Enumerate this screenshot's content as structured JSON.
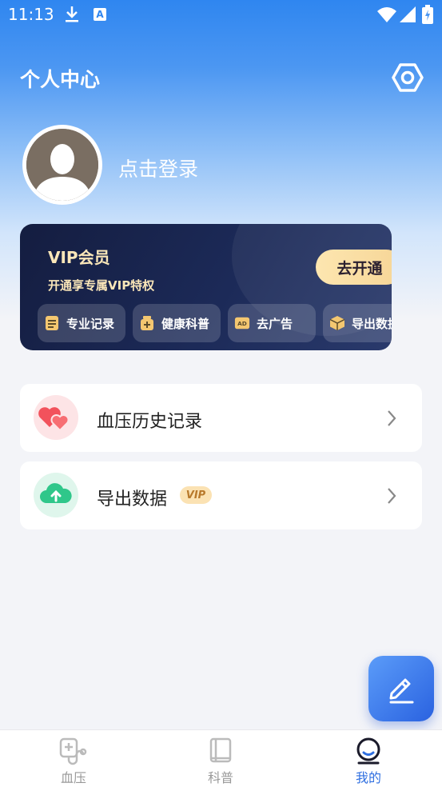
{
  "status_bar": {
    "time": "11:13"
  },
  "header": {
    "title": "个人中心"
  },
  "profile": {
    "login_text": "点击登录"
  },
  "vip_card": {
    "title": "VIP会员",
    "subtitle": "开通享专属VIP特权",
    "open_button": "去开通",
    "perks": [
      {
        "label": "专业记录",
        "icon": "document-icon"
      },
      {
        "label": "健康科普",
        "icon": "medicine-bottle-icon"
      },
      {
        "label": "去广告",
        "icon": "ad-icon"
      },
      {
        "label": "导出数据",
        "icon": "box-icon"
      }
    ]
  },
  "menu": [
    {
      "label": "血压历史记录",
      "icon": "hearts-icon"
    },
    {
      "label": "导出数据",
      "icon": "cloud-upload-icon",
      "badge": "VIP"
    }
  ],
  "bottom_nav": [
    {
      "label": "血压",
      "icon": "stethoscope-icon",
      "active": false
    },
    {
      "label": "科普",
      "icon": "book-icon",
      "active": false
    },
    {
      "label": "我的",
      "icon": "profile-icon",
      "active": true
    }
  ],
  "colors": {
    "accent": "#2f6fe0",
    "vip_gold": "#fbe7b9",
    "vip_card_bg": "#1c2a58"
  }
}
